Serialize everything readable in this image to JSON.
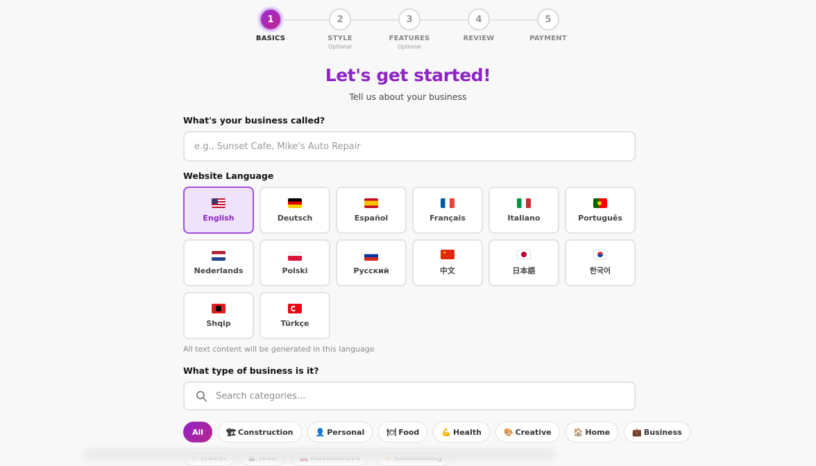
{
  "stepper": {
    "steps": [
      {
        "number": "1",
        "label": "BASICS",
        "sub": "",
        "active": true
      },
      {
        "number": "2",
        "label": "STYLE",
        "sub": "Optional",
        "active": false
      },
      {
        "number": "3",
        "label": "FEATURES",
        "sub": "Optional",
        "active": false
      },
      {
        "number": "4",
        "label": "REVIEW",
        "sub": "",
        "active": false
      },
      {
        "number": "5",
        "label": "PAYMENT",
        "sub": "",
        "active": false
      }
    ]
  },
  "header": {
    "title": "Let's get started!",
    "subtitle": "Tell us about your business"
  },
  "business_name": {
    "label": "What's your business called?",
    "placeholder": "e.g., Sunset Cafe, Mike's Auto Repair",
    "value": ""
  },
  "language": {
    "label": "Website Language",
    "hint": "All text content will be generated in this language",
    "options": [
      {
        "name": "English",
        "flag": "us",
        "selected": true
      },
      {
        "name": "Deutsch",
        "flag": "de",
        "selected": false
      },
      {
        "name": "Español",
        "flag": "es",
        "selected": false
      },
      {
        "name": "Français",
        "flag": "fr",
        "selected": false
      },
      {
        "name": "Italiano",
        "flag": "it",
        "selected": false
      },
      {
        "name": "Português",
        "flag": "pt",
        "selected": false
      },
      {
        "name": "Nederlands",
        "flag": "nl",
        "selected": false
      },
      {
        "name": "Polski",
        "flag": "pl",
        "selected": false
      },
      {
        "name": "Русский",
        "flag": "ru",
        "selected": false
      },
      {
        "name": "中文",
        "flag": "cn",
        "selected": false
      },
      {
        "name": "日本語",
        "flag": "jp",
        "selected": false
      },
      {
        "name": "한국어",
        "flag": "kr",
        "selected": false
      },
      {
        "name": "Shqip",
        "flag": "al",
        "selected": false
      },
      {
        "name": "Türkçe",
        "flag": "tr",
        "selected": false
      }
    ]
  },
  "business_type": {
    "label": "What type of business is it?",
    "search_placeholder": "Search categories...",
    "search_icon": "search-icon",
    "categories_row1": [
      {
        "label": "All",
        "icon": "",
        "active": true
      },
      {
        "label": "Construction",
        "icon": "🏗",
        "active": false
      },
      {
        "label": "Personal",
        "icon": "👤",
        "active": false
      },
      {
        "label": "Food",
        "icon": "🍽",
        "active": false
      },
      {
        "label": "Health",
        "icon": "💪",
        "active": false
      },
      {
        "label": "Creative",
        "icon": "🎨",
        "active": false
      },
      {
        "label": "Home",
        "icon": "🏠",
        "active": false
      },
      {
        "label": "Business",
        "icon": "💼",
        "active": false
      }
    ],
    "categories_row2": [
      {
        "label": "Travel",
        "icon": "✈"
      },
      {
        "label": "Tech",
        "icon": "■"
      },
      {
        "label": "Automotive",
        "icon": "🚗"
      },
      {
        "label": "Community",
        "icon": "🤝"
      }
    ]
  },
  "colors": {
    "accent": "#8e24c4",
    "accent_bg": "#efe3fa",
    "border": "#e2e2e2"
  }
}
